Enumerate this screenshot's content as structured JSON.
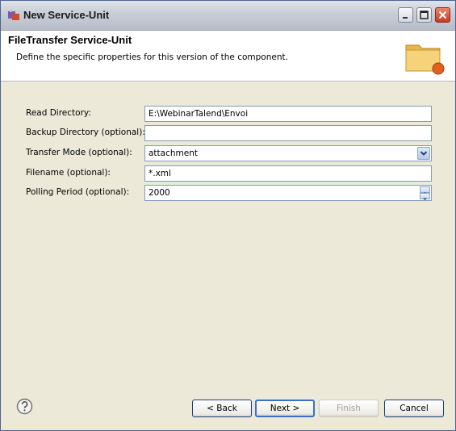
{
  "window": {
    "title": "New Service-Unit"
  },
  "header": {
    "title": "FileTransfer Service-Unit",
    "description": "Define the specific properties for this version of the component."
  },
  "form": {
    "fields": [
      {
        "label": "Read Directory:",
        "value": "E:\\WebinarTalend\\Envoi"
      },
      {
        "label": "Backup Directory (optional):",
        "value": ""
      },
      {
        "label": "Transfer Mode (optional):",
        "value": "attachment"
      },
      {
        "label": "Filename (optional):",
        "value": "*.xml"
      },
      {
        "label": "Polling Period (optional):",
        "value": "2000"
      }
    ]
  },
  "buttons": {
    "back": "< Back",
    "next": "Next >",
    "finish": "Finish",
    "cancel": "Cancel"
  },
  "icons": {
    "app": "eclipse-app-icon",
    "banner": "folder-icon",
    "help": "help-icon"
  },
  "colors": {
    "dialog_background": "#ece9d8",
    "field_border": "#7f9db9",
    "default_button_border": "#3c6fc6"
  }
}
